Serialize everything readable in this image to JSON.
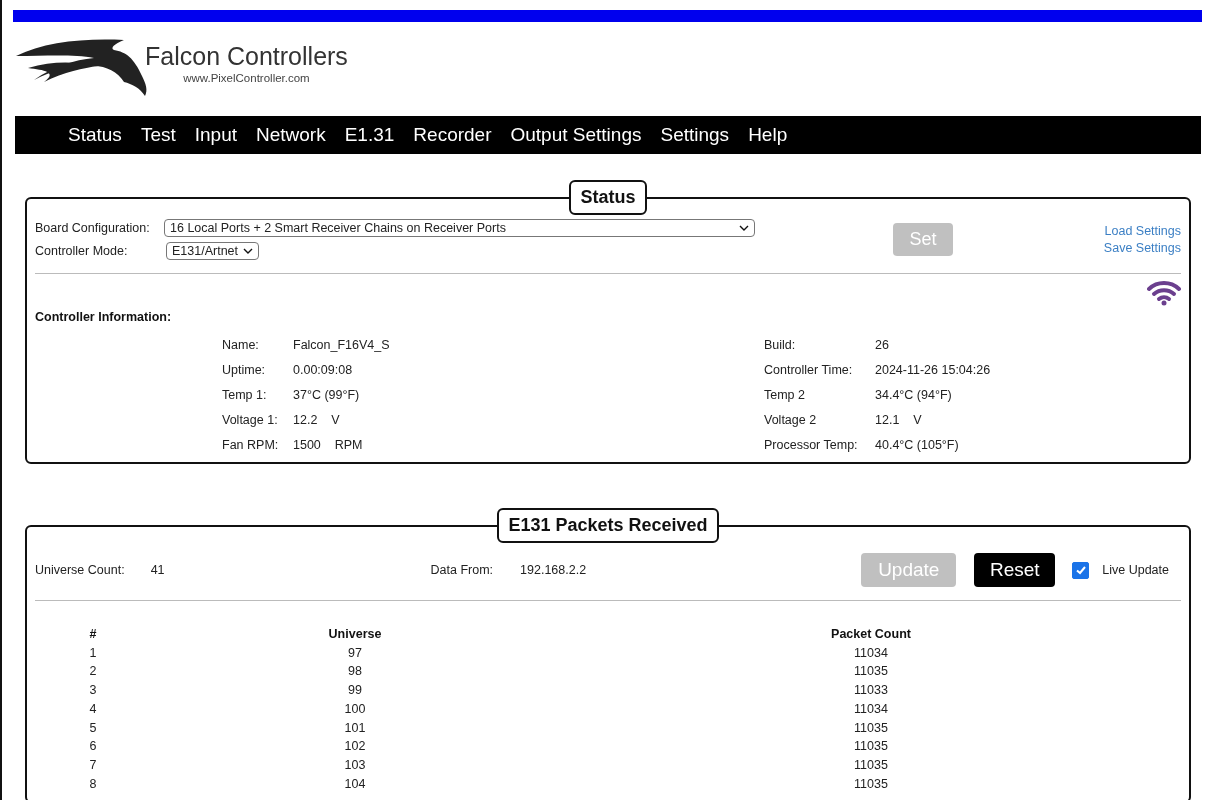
{
  "header": {
    "brand": "Falcon Controllers",
    "url": "www.PixelController.com"
  },
  "nav": [
    {
      "label": "Status"
    },
    {
      "label": "Test"
    },
    {
      "label": "Input"
    },
    {
      "label": "Network"
    },
    {
      "label": "E1.31"
    },
    {
      "label": "Recorder"
    },
    {
      "label": "Output Settings"
    },
    {
      "label": "Settings"
    },
    {
      "label": "Help"
    }
  ],
  "status": {
    "title": "Status",
    "board_configuration": {
      "label": "Board Configuration:",
      "value": "16 Local Ports + 2 Smart Receiver Chains on Receiver Ports"
    },
    "controller_mode": {
      "label": "Controller Mode:",
      "value": "E131/Artnet"
    },
    "set_button": {
      "label": "Set",
      "disabled": true
    },
    "links": [
      "Load Settings",
      "Save Settings"
    ],
    "info_title": "Controller Information:",
    "info_rows": [
      {
        "label": "Name:",
        "value": "Falcon_F16V4_S",
        "label_2": "Build:",
        "value_2": "26"
      },
      {
        "label": "Uptime:",
        "value": "0.00:09:08",
        "label_2": "Controller Time:",
        "value_2": "2024-11-26 15:04:26"
      },
      {
        "label": "Temp 1:",
        "value": "37°C (99°F)",
        "label_2": "Temp 2",
        "value_2": "34.4°C (94°F)"
      },
      {
        "label": "Voltage 1:",
        "value": "12.2    V",
        "label_2": "Voltage 2",
        "value_2": "12.1    V"
      },
      {
        "label": "Fan RPM:",
        "value": "1500    RPM",
        "label_2": "Processor Temp:",
        "value_2": "40.4°C (105°F)"
      }
    ]
  },
  "packets": {
    "title": "E131 Packets Received",
    "universe_count": {
      "label": "Universe Count:",
      "value": "41"
    },
    "data_from": {
      "label": "Data From:",
      "value": "192.168.2.2"
    },
    "update_button": {
      "label": "Update",
      "disabled": true
    },
    "reset_button": {
      "label": "Reset",
      "disabled": false
    },
    "live_update": {
      "label": "Live Update",
      "checked": true
    },
    "table": {
      "columns": [
        "#",
        "Universe",
        "Packet Count"
      ],
      "rows": [
        [
          "1",
          "97",
          "11034"
        ],
        [
          "2",
          "98",
          "11035"
        ],
        [
          "3",
          "99",
          "11033"
        ],
        [
          "4",
          "100",
          "11034"
        ],
        [
          "5",
          "101",
          "11035"
        ],
        [
          "6",
          "102",
          "11035"
        ],
        [
          "7",
          "103",
          "11035"
        ],
        [
          "8",
          "104",
          "11035"
        ]
      ]
    }
  }
}
